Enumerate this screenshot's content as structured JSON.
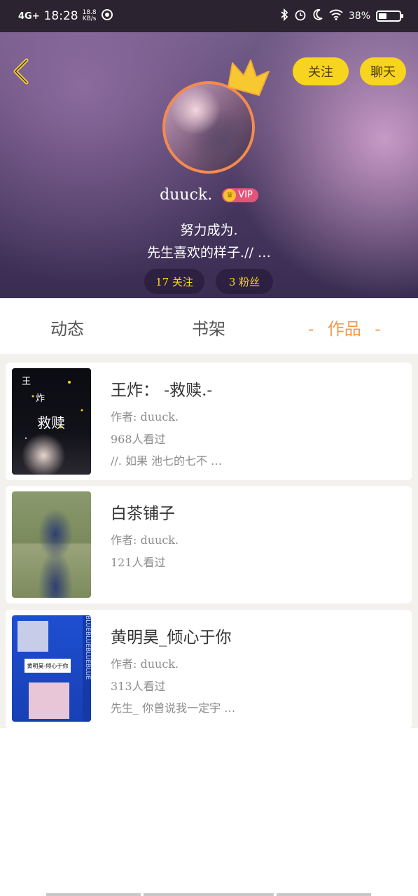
{
  "status_bar": {
    "network": "4G+",
    "time": "18:28",
    "speed_top": "18.8",
    "speed_unit": "KB/s",
    "battery_text": "38%",
    "battery_level": 0.38
  },
  "header": {
    "follow_button": "关注",
    "chat_button": "聊天",
    "username": "duuck.",
    "vip_label": "VIP",
    "bio_line1": "努力成为.",
    "bio_line2": "先生喜欢的样子.// …",
    "following_stat": "17 关注",
    "fans_stat": "3 粉丝"
  },
  "tabs": {
    "dynamic": "动态",
    "bookshelf": "书架",
    "works": "作品",
    "works_dash_left": "-",
    "works_dash_right": "-"
  },
  "works": [
    {
      "title": "王炸： -救赎.-",
      "author": "作者: duuck.",
      "views": "968人看过",
      "excerpt": "//. 如果 池七的七不 …",
      "cover_text": [
        "王",
        "炸",
        "救赎"
      ]
    },
    {
      "title": "白茶铺子",
      "author": "作者: duuck.",
      "views": "121人看过"
    },
    {
      "title": "黄明昊_倾心于你",
      "author": "作者: duuck.",
      "views": "313人看过",
      "excerpt": "先生_ 你曾说我一定宇 …",
      "cover_text": [
        "黄明昊-倾心于你",
        "BLUEBLUEBLUEBLUE"
      ]
    }
  ],
  "colors": {
    "accent_yellow": "#f7d51f",
    "accent_orange": "#f39a4a",
    "avatar_border": "#f58a4f",
    "vip_pink": "#e6537a"
  }
}
